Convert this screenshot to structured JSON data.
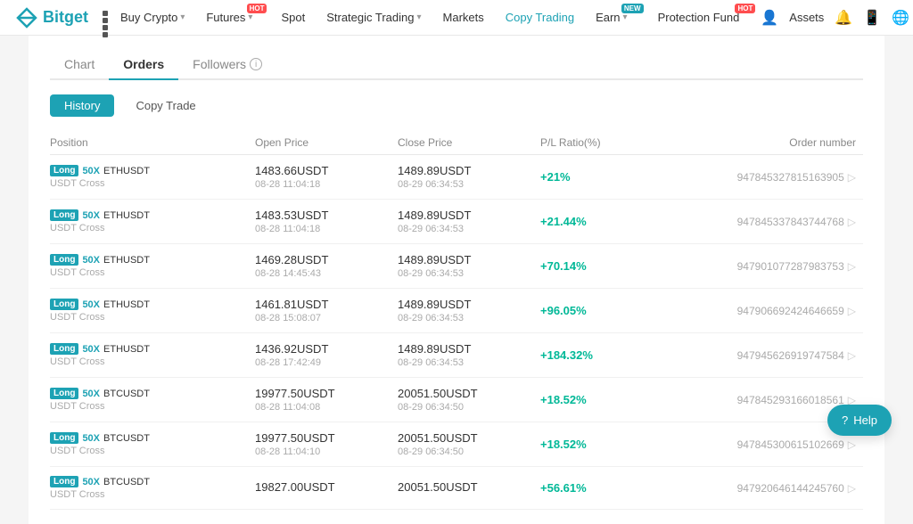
{
  "navbar": {
    "logo_text": "Bitget",
    "items": [
      {
        "label": "Buy Crypto",
        "has_dropdown": true,
        "badge": null
      },
      {
        "label": "Futures",
        "has_dropdown": true,
        "badge": "HOT"
      },
      {
        "label": "Spot",
        "has_dropdown": false,
        "badge": null
      },
      {
        "label": "Strategic Trading",
        "has_dropdown": true,
        "badge": null
      },
      {
        "label": "Markets",
        "has_dropdown": false,
        "badge": null
      },
      {
        "label": "Copy Trading",
        "has_dropdown": false,
        "badge": null,
        "active": true
      },
      {
        "label": "Earn",
        "has_dropdown": true,
        "badge": "NEW"
      },
      {
        "label": "Protection Fund",
        "has_dropdown": false,
        "badge": "HOT"
      }
    ],
    "assets_label": "Assets"
  },
  "tabs": [
    {
      "label": "Chart",
      "active": false
    },
    {
      "label": "Orders",
      "active": true
    },
    {
      "label": "Followers",
      "active": false
    }
  ],
  "sub_tabs": [
    {
      "label": "History",
      "active": true
    },
    {
      "label": "Copy Trade",
      "active": false
    }
  ],
  "table": {
    "headers": [
      "Position",
      "Open Price",
      "Close Price",
      "P/L Ratio(%)",
      "Order number"
    ],
    "rows": [
      {
        "direction": "Long",
        "leverage": "50X",
        "pair": "ETHUSDT",
        "sub": "USDT Cross",
        "open_price": "1483.66USDT",
        "open_date": "08-28 11:04:18",
        "close_price": "1489.89USDT",
        "close_date": "08-29 06:34:53",
        "pl": "+21%",
        "order_num": "947845327815163905"
      },
      {
        "direction": "Long",
        "leverage": "50X",
        "pair": "ETHUSDT",
        "sub": "USDT Cross",
        "open_price": "1483.53USDT",
        "open_date": "08-28 11:04:18",
        "close_price": "1489.89USDT",
        "close_date": "08-29 06:34:53",
        "pl": "+21.44%",
        "order_num": "947845337843744768"
      },
      {
        "direction": "Long",
        "leverage": "50X",
        "pair": "ETHUSDT",
        "sub": "USDT Cross",
        "open_price": "1469.28USDT",
        "open_date": "08-28 14:45:43",
        "close_price": "1489.89USDT",
        "close_date": "08-29 06:34:53",
        "pl": "+70.14%",
        "order_num": "947901077287983753"
      },
      {
        "direction": "Long",
        "leverage": "50X",
        "pair": "ETHUSDT",
        "sub": "USDT Cross",
        "open_price": "1461.81USDT",
        "open_date": "08-28 15:08:07",
        "close_price": "1489.89USDT",
        "close_date": "08-29 06:34:53",
        "pl": "+96.05%",
        "order_num": "947906692424646659"
      },
      {
        "direction": "Long",
        "leverage": "50X",
        "pair": "ETHUSDT",
        "sub": "USDT Cross",
        "open_price": "1436.92USDT",
        "open_date": "08-28 17:42:49",
        "close_price": "1489.89USDT",
        "close_date": "08-29 06:34:53",
        "pl": "+184.32%",
        "order_num": "947945626919747584"
      },
      {
        "direction": "Long",
        "leverage": "50X",
        "pair": "BTCUSDT",
        "sub": "USDT Cross",
        "open_price": "19977.50USDT",
        "open_date": "08-28 11:04:08",
        "close_price": "20051.50USDT",
        "close_date": "08-29 06:34:50",
        "pl": "+18.52%",
        "order_num": "947845293166018561"
      },
      {
        "direction": "Long",
        "leverage": "50X",
        "pair": "BTCUSDT",
        "sub": "USDT Cross",
        "open_price": "19977.50USDT",
        "open_date": "08-28 11:04:10",
        "close_price": "20051.50USDT",
        "close_date": "08-29 06:34:50",
        "pl": "+18.52%",
        "order_num": "947845300615102669"
      },
      {
        "direction": "Long",
        "leverage": "50X",
        "pair": "BTCUSDT",
        "sub": "USDT Cross",
        "open_price": "19827.00USDT",
        "open_date": "",
        "close_price": "20051.50USDT",
        "close_date": "",
        "pl": "+56.61%",
        "order_num": "947920646144245760"
      }
    ]
  },
  "help_label": "Help"
}
